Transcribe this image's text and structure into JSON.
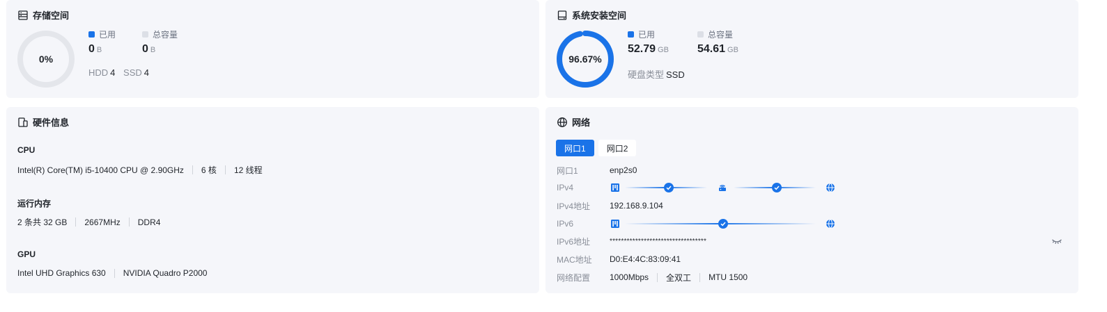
{
  "storage": {
    "title": "存储空间",
    "percent_label": "0%",
    "used_fraction": 0,
    "used_label": "已用",
    "used_value": "0",
    "used_unit": "B",
    "total_label": "总容量",
    "total_value": "0",
    "total_unit": "B",
    "hdd_label": "HDD",
    "hdd_count": "4",
    "ssd_label": "SSD",
    "ssd_count": "4"
  },
  "system": {
    "title": "系统安装空间",
    "percent_label": "96.67%",
    "used_fraction": 0.9667,
    "used_label": "已用",
    "used_value": "52.79",
    "used_unit": "GB",
    "total_label": "总容量",
    "total_value": "54.61",
    "total_unit": "GB",
    "disk_type_label": "硬盘类型",
    "disk_type_value": "SSD"
  },
  "hardware": {
    "title": "硬件信息",
    "cpu_label": "CPU",
    "cpu_model": "Intel(R) Core(TM) i5-10400 CPU @ 2.90GHz",
    "cpu_cores": "6 核",
    "cpu_threads": "12 线程",
    "mem_label": "运行内存",
    "mem_size": "2 条共 32 GB",
    "mem_freq": "2667MHz",
    "mem_type": "DDR4",
    "gpu_label": "GPU",
    "gpu_1": "Intel UHD Graphics 630",
    "gpu_2": "NVIDIA Quadro P2000"
  },
  "network": {
    "title": "网络",
    "tabs": [
      "网口1",
      "网口2"
    ],
    "rows": {
      "port_label": "网口1",
      "port_value": "enp2s0",
      "ipv4_label": "IPv4",
      "ipv4_addr_label": "IPv4地址",
      "ipv4_addr_value": "192.168.9.104",
      "ipv6_label": "IPv6",
      "ipv6_addr_label": "IPv6地址",
      "ipv6_addr_value": "**********************************",
      "mac_label": "MAC地址",
      "mac_value": "D0:E4:4C:83:09:41",
      "config_label": "网络配置",
      "config_speed": "1000Mbps",
      "config_duplex": "全双工",
      "config_mtu": "MTU 1500"
    }
  },
  "colors": {
    "accent": "#1a73e8",
    "track": "#e4e6eb",
    "legend_total": "#dcdfe6"
  }
}
